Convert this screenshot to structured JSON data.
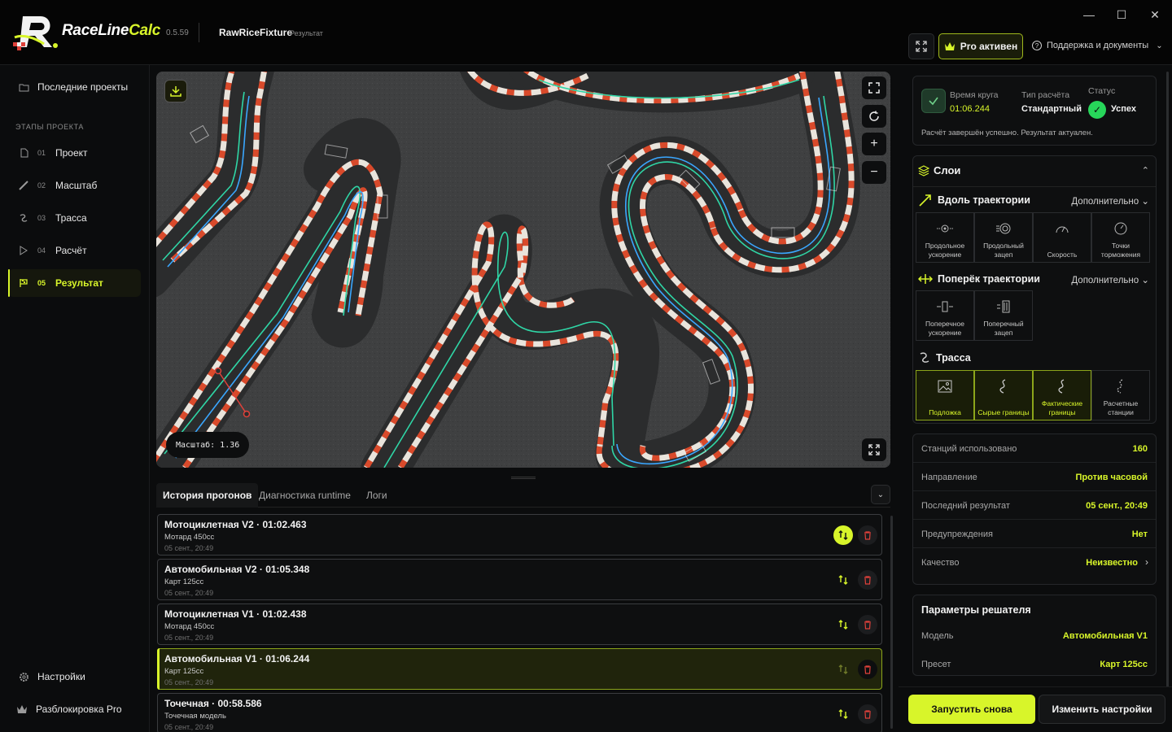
{
  "app": {
    "name_main": "RaceLine",
    "name_accent": "Calc",
    "version": "0.5.59"
  },
  "project": {
    "name": "RawRiceFixture",
    "subtitle": "Результат"
  },
  "titlebar": {
    "pro_label": "Pro активен",
    "support_label": "Поддержка и документы"
  },
  "sidebar": {
    "recent": "Последние проекты",
    "stages_heading": "ЭТАПЫ ПРОЕКТА",
    "stages": [
      {
        "num": "01",
        "label": "Проект"
      },
      {
        "num": "02",
        "label": "Масштаб"
      },
      {
        "num": "03",
        "label": "Трасса"
      },
      {
        "num": "04",
        "label": "Расчёт"
      },
      {
        "num": "05",
        "label": "Результат"
      }
    ],
    "settings": "Настройки",
    "unlock": "Разблокировка Pro"
  },
  "map": {
    "scale_text": "Масштаб: 1.36"
  },
  "tabs": [
    "История прогонов",
    "Диагностика runtime",
    "Логи"
  ],
  "runs": [
    {
      "title": "Мотоциклетная V2 · 01:02.463",
      "model": "Мотард 450cc",
      "date": "05 сент., 20:49"
    },
    {
      "title": "Автомобильная V2 · 01:05.348",
      "model": "Карт 125cc",
      "date": "05 сент., 20:49"
    },
    {
      "title": "Мотоциклетная V1 · 01:02.438",
      "model": "Мотард 450cc",
      "date": "05 сент., 20:49"
    },
    {
      "title": "Автомобильная V1 · 01:06.244",
      "model": "Карт 125cc",
      "date": "05 сент., 20:49"
    },
    {
      "title": "Точечная · 00:58.586",
      "model": "Точечная модель",
      "date": "05 сент., 20:49"
    }
  ],
  "summary": {
    "lap_label": "Время круга",
    "lap_value": "01:06.244",
    "type_label": "Тип расчёта",
    "type_value": "Стандартный",
    "status_label": "Статус",
    "status_value": "Успех",
    "message": "Расчёт завершён успешно. Результат актуален."
  },
  "layers": {
    "title": "Слои",
    "along": {
      "title": "Вдоль траектории",
      "more": "Дополнительно",
      "tiles": [
        "Продольное ускорение",
        "Продольный зацеп",
        "Скорость",
        "Точки торможения"
      ]
    },
    "across": {
      "title": "Поперёк траектории",
      "more": "Дополнительно",
      "tiles": [
        "Поперечное ускорение",
        "Поперечный зацеп"
      ]
    },
    "track": {
      "title": "Трасса",
      "tiles": [
        "Подложка",
        "Сырые границы",
        "Фактические границы",
        "Расчетные станции"
      ]
    }
  },
  "stats": [
    {
      "k": "Станций использовано",
      "v": "160"
    },
    {
      "k": "Направление",
      "v": "Против часовой"
    },
    {
      "k": "Последний результат",
      "v": "05 сент., 20:49"
    },
    {
      "k": "Предупреждения",
      "v": "Нет"
    },
    {
      "k": "Качество",
      "v": "Неизвестно"
    }
  ],
  "solver": {
    "title": "Параметры решателя",
    "model_label": "Модель",
    "model_value": "Автомобильная V1",
    "preset_label": "Пресет",
    "preset_value": "Карт 125cc"
  },
  "actions": {
    "run_again": "Запустить снова",
    "change_settings": "Изменить настройки"
  },
  "colors": {
    "accent": "#d8f52a",
    "success": "#27d65a",
    "danger": "#e0413a"
  }
}
